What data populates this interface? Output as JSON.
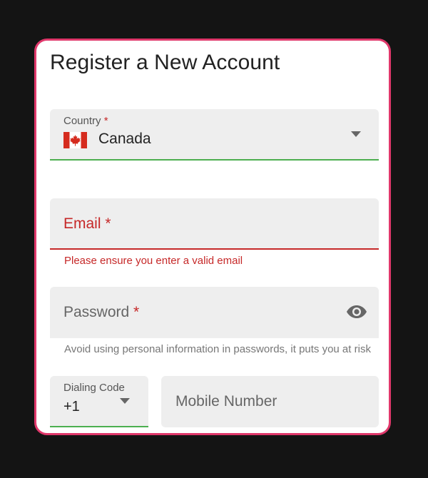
{
  "form": {
    "title": "Register a New Account",
    "required_marker": "*",
    "country": {
      "label": "Country",
      "value": "Canada",
      "flag_icon": "canada-flag-icon"
    },
    "email": {
      "placeholder": "Email",
      "error": "Please ensure you enter a valid email"
    },
    "password": {
      "placeholder": "Password",
      "toggle_icon": "eye-icon",
      "helper": "Avoid using personal information in passwords, it puts you at risk"
    },
    "dialing_code": {
      "label": "Dialing Code",
      "value": "+1"
    },
    "mobile": {
      "placeholder": "Mobile Number"
    }
  },
  "colors": {
    "card_border": "#e0386b",
    "error": "#c62828",
    "valid_underline": "#4caf50",
    "field_background": "#eeeeee",
    "page_background": "#141414"
  }
}
